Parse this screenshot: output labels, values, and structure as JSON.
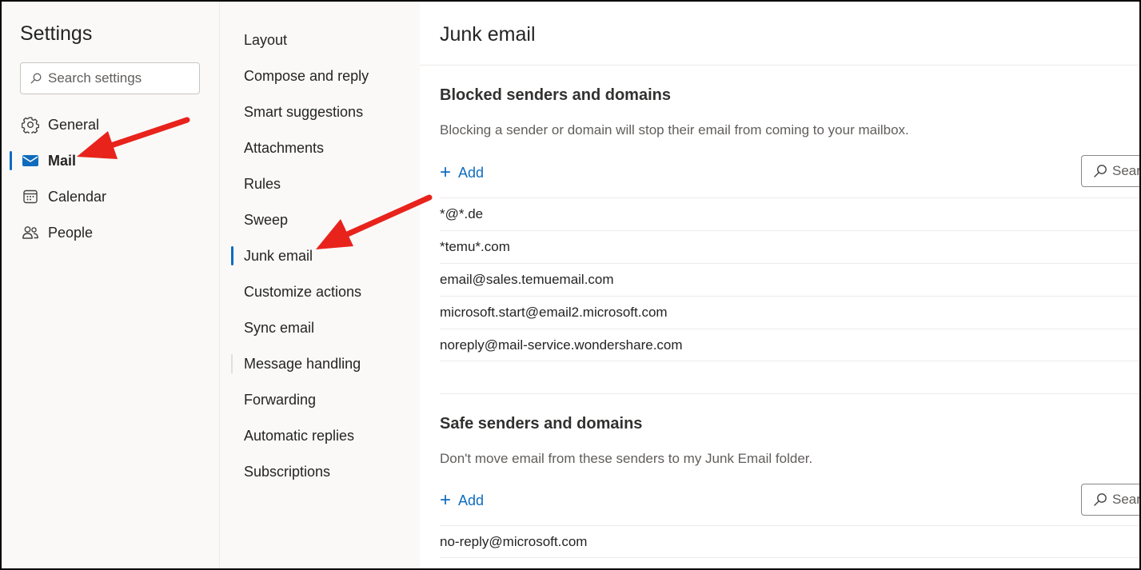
{
  "settings": {
    "title": "Settings",
    "search_placeholder": "Search settings",
    "nav": [
      {
        "label": "General",
        "icon": "gear-icon"
      },
      {
        "label": "Mail",
        "icon": "envelope-icon",
        "selected": true
      },
      {
        "label": "Calendar",
        "icon": "calendar-icon"
      },
      {
        "label": "People",
        "icon": "people-icon"
      }
    ]
  },
  "mail_settings": {
    "items": [
      "Layout",
      "Compose and reply",
      "Smart suggestions",
      "Attachments",
      "Rules",
      "Sweep",
      "Junk email",
      "Customize actions",
      "Sync email",
      "Message handling",
      "Forwarding",
      "Automatic replies",
      "Subscriptions"
    ],
    "selected": "Junk email"
  },
  "content": {
    "title": "Junk email",
    "blocked": {
      "title": "Blocked senders and domains",
      "description": "Blocking a sender or domain will stop their email from coming to your mailbox.",
      "add_label": "Add",
      "search_placeholder": "Search",
      "entries": [
        "*@*.de",
        "*temu*.com",
        "email@sales.temuemail.com",
        "microsoft.start@email2.microsoft.com",
        "noreply@mail-service.wondershare.com"
      ]
    },
    "safe": {
      "title": "Safe senders and domains",
      "description": "Don't move email from these senders to my Junk Email folder.",
      "add_label": "Add",
      "search_placeholder": "Search",
      "entries": [
        "no-reply@microsoft.com"
      ]
    }
  },
  "colors": {
    "accent": "#0f6cbd",
    "annotation_arrow": "#e8231c"
  }
}
